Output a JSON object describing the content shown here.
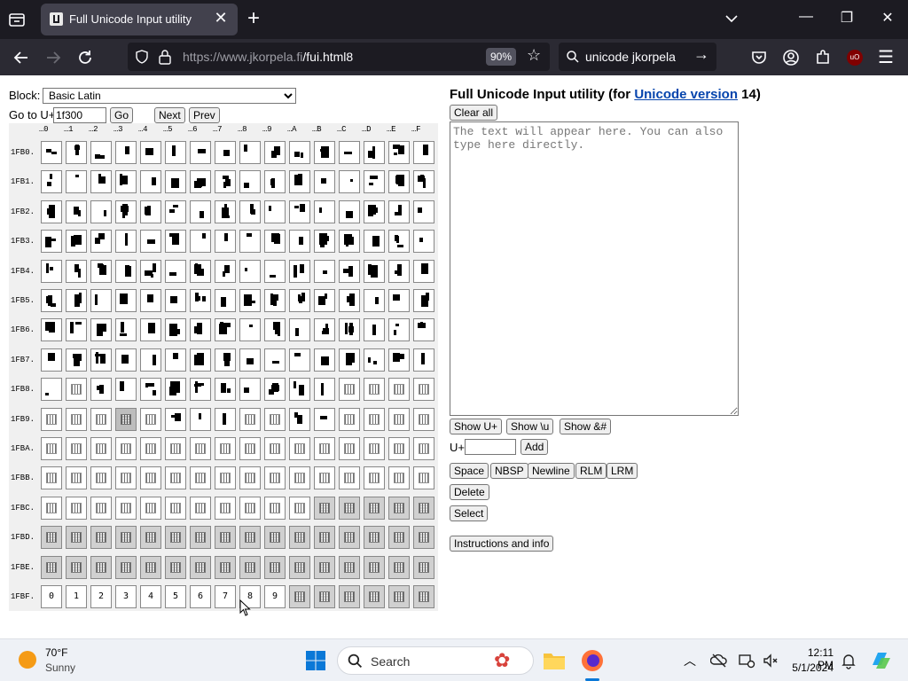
{
  "browser": {
    "tab_title": "Full Unicode Input utility",
    "url_host": "https://www.jkorpela.fi",
    "url_path": "/fui.html8",
    "zoom": "90%",
    "search_query": "unicode jkorpela"
  },
  "left": {
    "block_label": "Block:",
    "block_value": "Basic Latin",
    "goto_label": "Go to U+",
    "goto_value": "1f300",
    "go_button": "Go",
    "next_button": "Next",
    "prev_button": "Prev"
  },
  "grid": {
    "column_headers": [
      "…0",
      "…1",
      "…2",
      "…3",
      "…4",
      "…5",
      "…6",
      "…7",
      "…8",
      "…9",
      "…A",
      "…B",
      "…C",
      "…D",
      "…E",
      "…F"
    ],
    "row_headers": [
      "1FB0.",
      "1FB1.",
      "1FB2.",
      "1FB3.",
      "1FB4.",
      "1FB5.",
      "1FB6.",
      "1FB7.",
      "1FB8.",
      "1FB9.",
      "1FBA.",
      "1FBB.",
      "1FBC.",
      "1FBD.",
      "1FBE.",
      "1FBF."
    ],
    "digits_row": [
      "0",
      "1",
      "2",
      "3",
      "4",
      "5",
      "6",
      "7",
      "8",
      "9"
    ]
  },
  "right": {
    "title_prefix": "Full Unicode Input utility (for ",
    "title_link": "Unicode version",
    "title_suffix": " 14)",
    "clear_all": "Clear all",
    "textarea_placeholder": "The text will appear here. You can also type here directly.",
    "show_u": "Show U+",
    "show_backslash_u": "Show \\u",
    "show_entity": "Show &#",
    "uplus_label": "U+",
    "add_button": "Add",
    "space": "Space",
    "nbsp": "NBSP",
    "newline": "Newline",
    "rlm": "RLM",
    "lrm": "LRM",
    "delete": "Delete",
    "select": "Select",
    "instructions": "Instructions and info"
  },
  "taskbar": {
    "temperature": "70°F",
    "condition": "Sunny",
    "search_placeholder": "Search",
    "time": "12:11 PM",
    "date": "5/1/2024"
  },
  "colors": {
    "tabbar_bg": "#1c1b22",
    "navbar_bg": "#2b2a33",
    "link": "#0645ad",
    "undefined_cell": "#d0d0d0"
  }
}
